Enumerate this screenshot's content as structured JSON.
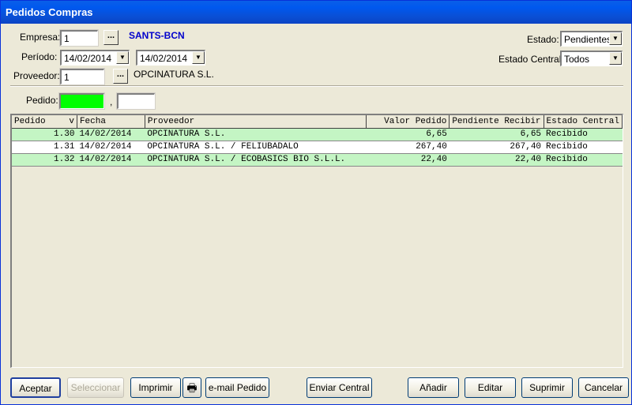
{
  "window": {
    "title": "Pedidos Compras"
  },
  "form": {
    "empresa_label": "Empresa:",
    "empresa_value": "1",
    "empresa_name": "SANTS-BCN",
    "periodo_label": "Período:",
    "periodo_from": "14/02/2014",
    "periodo_to": "14/02/2014",
    "proveedor_label": "Proveedor:",
    "proveedor_value": "1",
    "proveedor_name": "OPCINATURA S.L.",
    "estado_label": "Estado:",
    "estado_value": "Pendientes",
    "estado_central_label": "Estado Central:",
    "estado_central_value": "Todos",
    "pedido_label": "Pedido:",
    "pedido_sep": ",",
    "pedido_color": "#00ff00",
    "dots": "..."
  },
  "grid": {
    "headers": [
      "Pedido",
      "v",
      "Fecha",
      "Proveedor",
      "Valor Pedido",
      "Pendiente Recibir",
      "Estado Central"
    ],
    "rows": [
      {
        "pedido": "1.30",
        "fecha": "14/02/2014",
        "proveedor": "OPCINATURA S.L.",
        "valor": "6,65",
        "pendiente": "6,65",
        "estado": "Recibido",
        "color": "#c4f5c4"
      },
      {
        "pedido": "1.31",
        "fecha": "14/02/2014",
        "proveedor": "OPCINATURA S.L. / FELIUBADALO",
        "valor": "267,40",
        "pendiente": "267,40",
        "estado": "Recibido",
        "color": "#ffffff"
      },
      {
        "pedido": "1.32",
        "fecha": "14/02/2014",
        "proveedor": "OPCINATURA S.L. / ECOBASICS BIO S.L.L.",
        "valor": "22,40",
        "pendiente": "22,40",
        "estado": "Recibido",
        "color": "#c4f5c4"
      }
    ]
  },
  "buttons": {
    "aceptar": "Aceptar",
    "seleccionar": "Seleccionar",
    "imprimir": "Imprimir",
    "email": "e-mail Pedido",
    "enviar": "Enviar Central",
    "anadir": "Añadir",
    "editar": "Editar",
    "suprimir": "Suprimir",
    "cancelar": "Cancelar"
  }
}
